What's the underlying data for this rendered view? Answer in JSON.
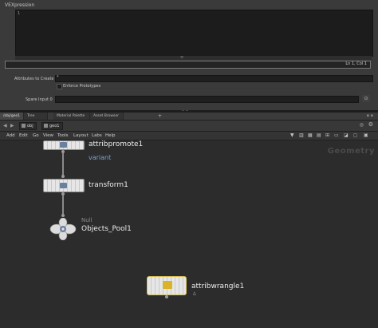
{
  "param_pane": {
    "title": "VEXpression",
    "line_number": "1",
    "status": "Ln 1, Col 1",
    "attributes_label": "Attributes to Create",
    "attributes_value": "*",
    "enforce_label": "Enforce Prototypes",
    "spare_label": "Spare Input 0"
  },
  "tabs": [
    {
      "label": "/obj/geo1",
      "active": true
    },
    {
      "label": "Tree View",
      "active": false
    },
    {
      "label": "Material Palette",
      "active": false
    },
    {
      "label": "Asset Browser",
      "active": false
    }
  ],
  "path": {
    "crumb1": "obj",
    "crumb2": "geo1"
  },
  "menu": [
    "Add",
    "Edit",
    "Go",
    "View",
    "Tools",
    "Layout",
    "Labs",
    "Help"
  ],
  "network": {
    "context_label": "Geometry",
    "nodes": {
      "attribpromote": {
        "name": "attribpromote1",
        "comment": "variant"
      },
      "transform": {
        "name": "transform1"
      },
      "null": {
        "type_label": "Null",
        "name": "Objects_Pool1"
      },
      "wrangle": {
        "name": "attribwrangle1"
      }
    }
  },
  "colors": {
    "accent": "#7fa3d4",
    "selection": "#d8c15a"
  }
}
